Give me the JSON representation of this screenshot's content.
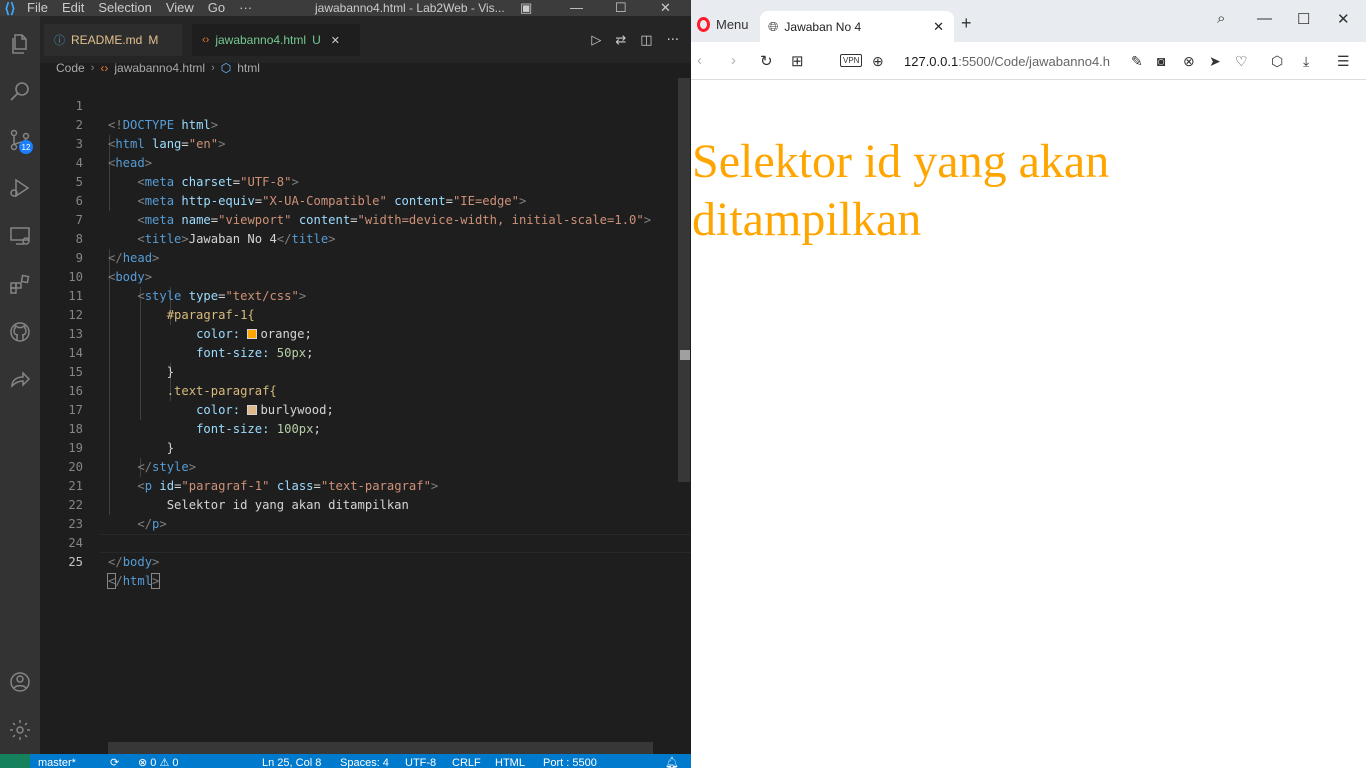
{
  "vscode": {
    "title": "jawabanno4.html - Lab2Web - Vis...",
    "menu": [
      "File",
      "Edit",
      "Selection",
      "View",
      "Go",
      "···"
    ],
    "source_control_badge": "12",
    "tabs": [
      {
        "label": "README.md",
        "status": "M"
      },
      {
        "label": "jawabanno4.html",
        "status": "U"
      }
    ],
    "breadcrumb": [
      "Code",
      "jawabanno4.html",
      "html"
    ],
    "code_lines": [
      {
        "n": "1"
      },
      {
        "n": "2"
      },
      {
        "n": "3"
      },
      {
        "n": "4"
      },
      {
        "n": "5"
      },
      {
        "n": "6"
      },
      {
        "n": "7"
      },
      {
        "n": "8"
      },
      {
        "n": "9"
      },
      {
        "n": "10"
      },
      {
        "n": "11"
      },
      {
        "n": "12"
      },
      {
        "n": "13"
      },
      {
        "n": "14"
      },
      {
        "n": "15"
      },
      {
        "n": "16"
      },
      {
        "n": "17"
      },
      {
        "n": "18"
      },
      {
        "n": "19"
      },
      {
        "n": "20"
      },
      {
        "n": "21"
      },
      {
        "n": "22"
      },
      {
        "n": "23"
      },
      {
        "n": "24"
      },
      {
        "n": "25"
      }
    ],
    "code": {
      "l1": "<!DOCTYPE html>",
      "l2_tag": "html",
      "l2_attr": "lang",
      "l2_val": "\"en\"",
      "l3": "head",
      "l4_attr": "charset",
      "l4_val": "\"UTF-8\"",
      "l5_attr1": "http-equiv",
      "l5_val1": "\"X-UA-Compatible\"",
      "l5_attr2": "content",
      "l5_val2": "\"IE=edge\"",
      "l6_attr1": "name",
      "l6_val1": "\"viewport\"",
      "l6_attr2": "content",
      "l6_val2": "\"width=device-width, initial-scale=1.0\"",
      "l7_text": "Jawaban No 4",
      "l10_attr": "type",
      "l10_val": "\"text/css\"",
      "l11_sel": "#paragraf-1{",
      "l12_prop": "color:",
      "l12_val": "orange;",
      "l13_prop": "font-size:",
      "l13_num": "50px",
      "l13_end": ";",
      "l14": "}",
      "l15_sel": ".text-paragraf{",
      "l16_prop": "color:",
      "l16_val": "burlywood;",
      "l17_prop": "font-size:",
      "l17_num": "100px",
      "l17_end": ";",
      "l18": "}",
      "l20_attr1": "id",
      "l20_val1": "\"paragraf-1\"",
      "l20_attr2": "class",
      "l20_val2": "\"text-paragraf\"",
      "l21_text": "Selektor id yang akan ditampilkan"
    },
    "swatches": {
      "orange": "#ffa500",
      "burlywood": "#deb887"
    },
    "status": {
      "branch": "master*",
      "problems": "⊗ 0 ⚠ 0",
      "position": "Ln 25, Col 8",
      "spaces": "Spaces: 4",
      "encoding": "UTF-8",
      "eol": "CRLF",
      "language": "HTML",
      "port": "Port : 5500"
    }
  },
  "browser": {
    "menu_label": "Menu",
    "tab_title": "Jawaban No 4",
    "url_host": "127.0.0.1",
    "url_rest": ":5500/Code/jawabanno4.h",
    "vpn_label": "VPN",
    "page_text": "Selektor id yang akan ditampilkan",
    "page_text_color": "#ffa500"
  }
}
